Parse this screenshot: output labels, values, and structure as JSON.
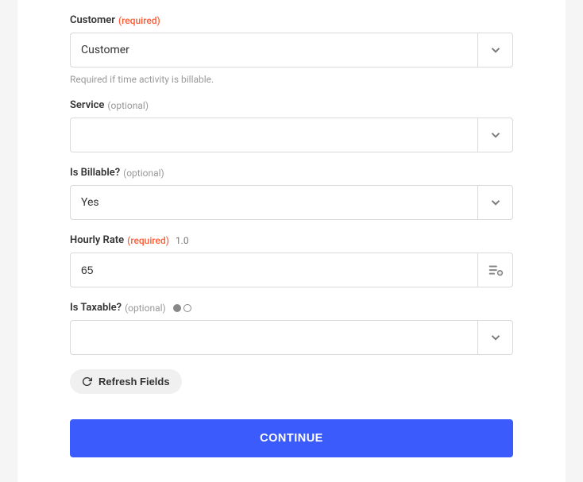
{
  "fields": {
    "customer": {
      "label": "Customer",
      "tag": "(required)",
      "value": "Customer",
      "help": "Required if time activity is billable."
    },
    "service": {
      "label": "Service",
      "tag": "(optional)",
      "value": ""
    },
    "isBillable": {
      "label": "Is Billable?",
      "tag": "(optional)",
      "value": "Yes"
    },
    "hourlyRate": {
      "label": "Hourly Rate",
      "tag": "(required)",
      "hint": "1.0",
      "value": "65"
    },
    "isTaxable": {
      "label": "Is Taxable?",
      "tag": "(optional)",
      "value": ""
    }
  },
  "actions": {
    "refresh": "Refresh Fields",
    "continue": "CONTINUE"
  }
}
